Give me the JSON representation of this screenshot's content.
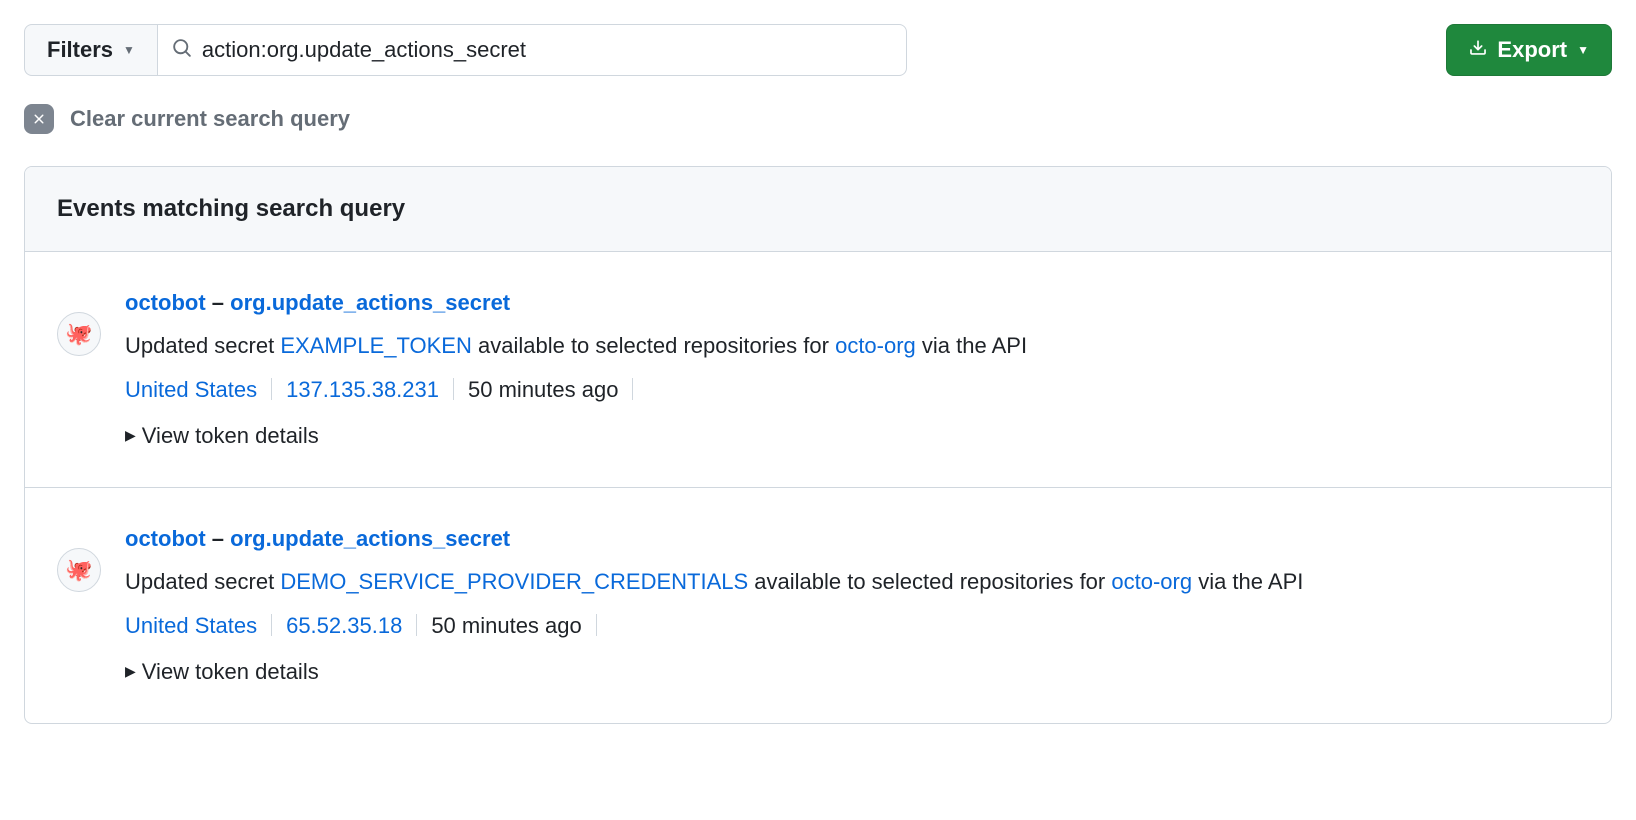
{
  "toolbar": {
    "filters_label": "Filters",
    "search_value": "action:org.update_actions_secret",
    "export_label": "Export"
  },
  "clear": {
    "text": "Clear current search query"
  },
  "panel": {
    "header": "Events matching search query"
  },
  "events": [
    {
      "actor": "octobot",
      "action": "org.update_actions_secret",
      "desc_prefix": "Updated secret ",
      "secret": "EXAMPLE_TOKEN",
      "desc_mid": " available to selected repositories for ",
      "org": "octo-org",
      "desc_suffix": " via the API",
      "location": "United States",
      "ip": "137.135.38.231",
      "time": "50 minutes ago",
      "details": "View token details",
      "avatar": "🐙"
    },
    {
      "actor": "octobot",
      "action": "org.update_actions_secret",
      "desc_prefix": "Updated secret ",
      "secret": "DEMO_SERVICE_PROVIDER_CREDENTIALS",
      "desc_mid": " available to selected repositories for ",
      "org": "octo-org",
      "desc_suffix": " via the API",
      "location": "United States",
      "ip": "65.52.35.18",
      "time": "50 minutes ago",
      "details": "View token details",
      "avatar": "🐙"
    }
  ]
}
